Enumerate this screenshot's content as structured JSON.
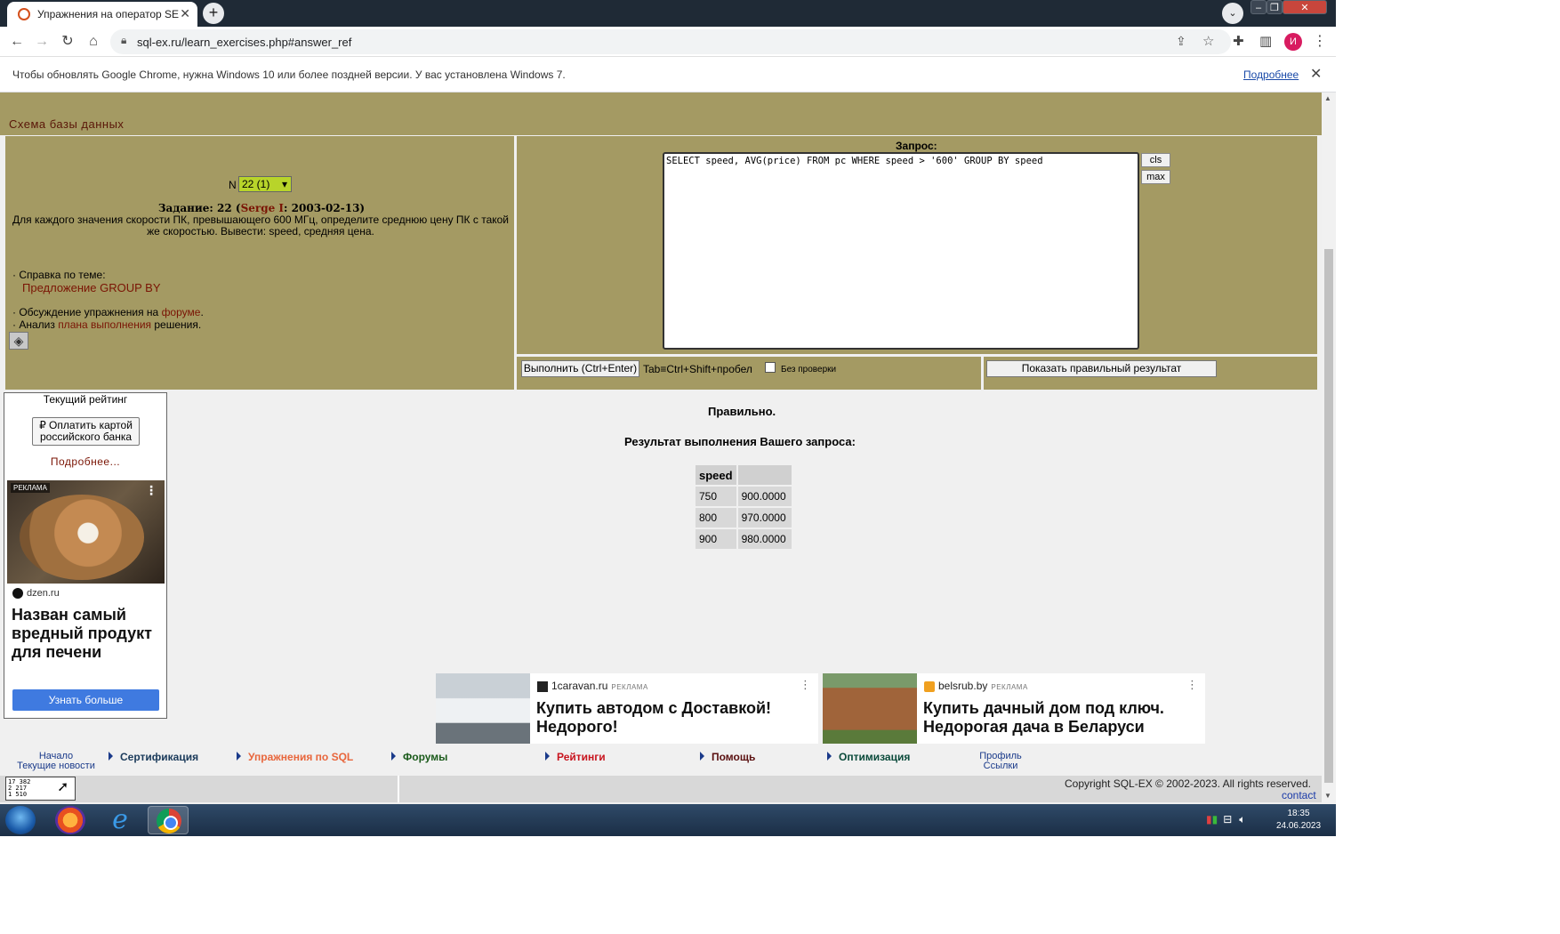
{
  "browser": {
    "tab_title": "Упражнения на оператор SELECT",
    "new_tab": "+",
    "url": "sql-ex.ru/learn_exercises.php#answer_ref",
    "avatar_letter": "И",
    "infobar_message": "Чтобы обновлять Google Chrome, нужна Windows 10 или более поздней версии. У вас установлена Windows 7.",
    "infobar_link": "Подробнее"
  },
  "page": {
    "schema_link": "Схема базы данных",
    "n_label": "N",
    "n_selected": "22 (1)",
    "task_prefix": "Задание: 22 (",
    "task_author": "Serge I",
    "task_suffix": ": 2003-02-13)",
    "task_description": "Для каждого значения скорости ПК, превышающего 600 МГц, определите среднюю цену ПК с такой же скоростью. Вывести: speed, средняя цена.",
    "help_label": "· Справка по теме:",
    "help_link": "Предложение GROUP BY",
    "discussion_prefix": "· Обсуждение упражнения на ",
    "discussion_link": "форуме",
    "discussion_suffix": ".",
    "plan_prefix": "· Анализ ",
    "plan_link": "плана выполнения",
    "plan_suffix": " решения.",
    "query_label": "Запрос:",
    "query_text": "SELECT speed, AVG(price) FROM pc WHERE speed > '600' GROUP BY speed",
    "cls_button": "cls",
    "max_button": "max",
    "run_button": "Выполнить (Ctrl+Enter)",
    "tab_hint": "Tab≡Ctrl+Shift+пробел",
    "no_check_label": "Без проверки",
    "show_result_button": "Показать правильный результат",
    "correct_text": "Правильно.",
    "result_title": "Результат выполнения Вашего запроса:",
    "result_table": {
      "headers": [
        "speed",
        ""
      ],
      "rows": [
        [
          "750",
          "900.0000"
        ],
        [
          "800",
          "970.0000"
        ],
        [
          "900",
          "980.0000"
        ]
      ]
    }
  },
  "rating": {
    "title": "Текущий рейтинг",
    "pay_button": "₽ Оплатить картой российского банка",
    "more_link": "Подробнее..."
  },
  "ads": {
    "side": {
      "badge": "РЕКЛАМА",
      "source": "dzen.ru",
      "headline": "Назван самый вредный продукт для печени",
      "button": "Узнать больше"
    },
    "bottom": [
      {
        "source": "1caravan.ru",
        "badge": "РЕКЛАМА",
        "headline": "Купить автодом с Доставкой! Недорого!"
      },
      {
        "source": "belsrub.by",
        "badge": "РЕКЛАМА",
        "headline": "Купить дачный дом под ключ. Недорогая дача в Беларуси"
      }
    ]
  },
  "footer": {
    "nav_left_1": "Начало",
    "nav_left_2": "Текущие новости",
    "items": [
      {
        "label": "Сертификация",
        "color": "#1a3a5a"
      },
      {
        "label": "Упражнения по SQL",
        "color": "#e8663c"
      },
      {
        "label": "Форумы",
        "color": "#1a5a1a"
      },
      {
        "label": "Рейтинги",
        "color": "#c8141e"
      },
      {
        "label": "Помощь",
        "color": "#5a1010"
      },
      {
        "label": "Оптимизация",
        "color": "#0a4a3a"
      }
    ],
    "nav_right_1": "Профиль",
    "nav_right_2": "Ссылки",
    "counter_lines": [
      "17 382",
      "2 217",
      "1 510"
    ],
    "copyright": "Copyright SQL-EX © 2002-2023. All rights reserved.",
    "contact": "contact"
  },
  "taskbar": {
    "time": "18:35",
    "date": "24.06.2023"
  }
}
